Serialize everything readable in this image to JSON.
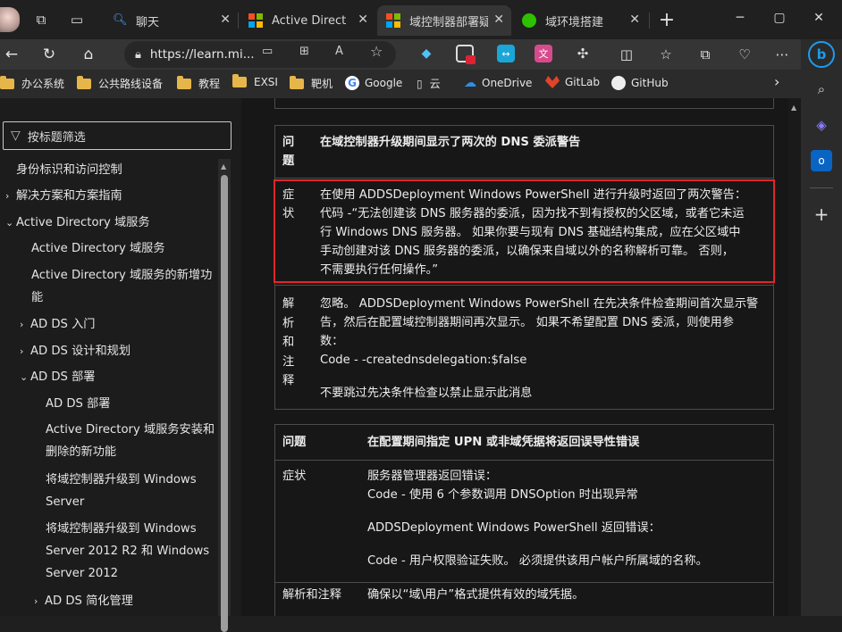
{
  "browser": {
    "tabs": [
      {
        "label": "",
        "icon": "copilot-icon"
      },
      {
        "label": "聊天",
        "icon": "search-icon"
      },
      {
        "label": "Active Directory",
        "icon": "microsoft-logo-icon"
      },
      {
        "label": "域控制器部署疑",
        "icon": "microsoft-logo-icon",
        "active": true
      },
      {
        "label": "域环境搭建",
        "icon": "wechat-icon"
      }
    ],
    "new_tab": "+",
    "address": {
      "url": "https://learn.mi..."
    },
    "favorites": [
      "办公系统",
      "公共路线设备",
      "教程",
      "EXSI",
      "靶机",
      "Google",
      "云",
      "OneDrive",
      "GitLab",
      "GitHub"
    ]
  },
  "nav": {
    "filter_placeholder": "按标题筛选",
    "items": [
      {
        "label": "身份标识和访问控制",
        "level": 0,
        "chevron": ""
      },
      {
        "label": "解决方案和方案指南",
        "level": 0,
        "chevron": "›"
      },
      {
        "label": "Active Directory 域服务",
        "level": 0,
        "chevron": "⌄"
      },
      {
        "label": "Active Directory 域服务",
        "level": 1,
        "chevron": ""
      },
      {
        "label": "Active Directory 域服务的新增功",
        "label2": "能",
        "level": 1,
        "chevron": ""
      },
      {
        "label": "AD DS 入门",
        "level": 1,
        "chevron": "›"
      },
      {
        "label": "AD DS 设计和规划",
        "level": 1,
        "chevron": "›"
      },
      {
        "label": "AD DS 部署",
        "level": 1,
        "chevron": "⌄"
      },
      {
        "label": "AD DS 部署",
        "level": 2,
        "chevron": ""
      },
      {
        "label": "Active Directory 域服务安装和",
        "label2": "删除的新功能",
        "level": 2,
        "chevron": ""
      },
      {
        "label": "将域控制器升级到 Windows",
        "label2": "Server",
        "level": 2,
        "chevron": ""
      },
      {
        "label": "将域控制器升级到 Windows",
        "label2": "Server 2012 R2 和 Windows",
        "label3": "Server 2012",
        "level": 2,
        "chevron": ""
      },
      {
        "label": "AD DS 简化管理",
        "level": 2,
        "chevron": "›"
      }
    ]
  },
  "table1": {
    "header_col1": [
      "问",
      "题"
    ],
    "header_col2": "在域控制器升级期间显示了两次的 DNS 委派警告",
    "symptom_col1": [
      "症",
      "状"
    ],
    "symptom_lines": [
      "在使用 ADDSDeployment Windows PowerShell 进行升级时返回了两次警告：",
      "代码 -“无法创建该 DNS 服务器的委派，因为找不到有授权的父区域，或者它未运",
      "行 Windows DNS 服务器。 如果你要与现有 DNS 基础结构集成，应在父区域中",
      "手动创建对该 DNS 服务器的委派，以确保来自域以外的名称解析可靠。 否则，",
      "不需要执行任何操作。”"
    ],
    "resolution_col1": [
      "解",
      "析",
      "和",
      "注",
      "释"
    ],
    "resolution_lines": [
      "忽略。 ADDSDeployment Windows PowerShell 在先决条件检查期间首次显示警",
      "告，然后在配置域控制器期间再次显示。 如果不希望配置 DNS 委派，则使用参",
      "数：",
      "Code - -creatednsdelegation:$false",
      "不要跳过先决条件检查以禁止显示此消息"
    ]
  },
  "table2": {
    "header_col1": "问题",
    "header_col2": "在配置期间指定 UPN 或非域凭据将返回误导性错误",
    "symptom_col1": "症状",
    "symptom_lines": [
      "服务器管理器返回错误：",
      "Code - 使用 6 个参数调用 DNSOption 时出现异常",
      "ADDSDeployment Windows PowerShell 返回错误：",
      "Code - 用户权限验证失败。 必须提供该用户帐户所属域的名称。"
    ],
    "resolution_col1": "解析和注释",
    "resolution_text": "确保以“域\\用户”格式提供有效的域凭据。"
  },
  "colors": {
    "highlight": "#e0262b",
    "ms_red": "#f25022",
    "ms_green": "#7fba00",
    "ms_blue": "#00a4ef",
    "ms_yellow": "#ffb900"
  }
}
